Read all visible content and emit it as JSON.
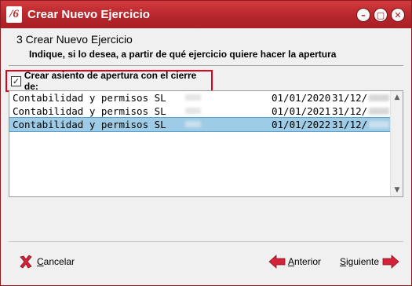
{
  "window": {
    "logo_text": "/6",
    "title": "Crear Nuevo Ejercicio"
  },
  "header": {
    "step_title": "3 Crear Nuevo Ejercicio",
    "subtitle": "Indique, si lo desea, a partir de qué ejercicio quiere hacer la apertura"
  },
  "option": {
    "checked": true,
    "label": "Crear asiento de apertura con el cierre de:"
  },
  "rows": [
    {
      "name": "Contabilidad y permisos SL",
      "start": "01/01/2020",
      "end": "31/12/"
    },
    {
      "name": "Contabilidad y permisos SL",
      "start": "01/01/2021",
      "end": "31/12/"
    },
    {
      "name": "Contabilidad y permisos SL",
      "start": "01/01/2022",
      "end": "31/12/"
    }
  ],
  "buttons": {
    "cancel": {
      "u": "C",
      "rest": "ancelar"
    },
    "back": {
      "u": "A",
      "rest": "nterior"
    },
    "next": {
      "u": "S",
      "rest": "iguiente"
    }
  },
  "colors": {
    "titlebar": "#b3262b",
    "highlight_border": "#e0001b",
    "selected_row": "#9ecbe5",
    "arrow_icon": "#d2233a"
  },
  "selected_row_index": 2
}
